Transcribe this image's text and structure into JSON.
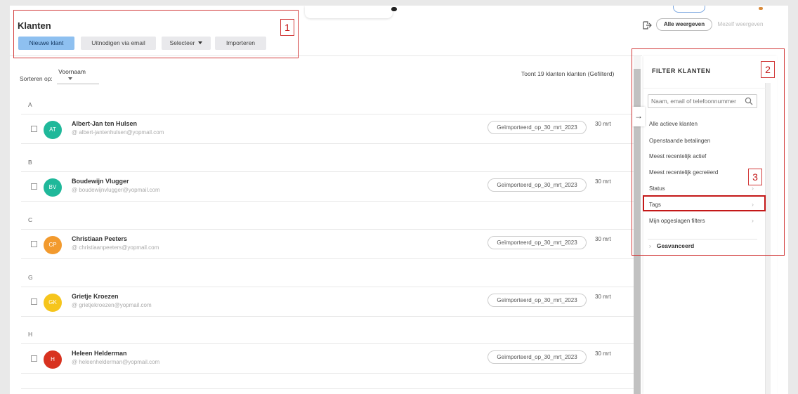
{
  "header": {
    "title": "Klanten",
    "buttons": {
      "new_client": "Nieuwe klant",
      "invite_email": "Uitnodigen via email",
      "select": "Selecteer",
      "import": "Importeren"
    },
    "view_all": "Alle weergeven",
    "view_self": "Mezelf weergeven"
  },
  "list": {
    "sort_label": "Sorteren op:",
    "sort_value": "Voornaam",
    "count_text": "Toont 19 klanten klanten (Gefilterd)",
    "sections": [
      {
        "letter": "A",
        "client": {
          "initials": "AT",
          "name": "Albert-Jan ten Hulsen",
          "email": "@  albert-jantenhulsen@yopmail.com",
          "tag": "Geïmporteerd_op_30_mrt_2023",
          "date": "30 mrt",
          "color": "#1fb89a"
        }
      },
      {
        "letter": "B",
        "client": {
          "initials": "BV",
          "name": "Boudewijn Vlugger",
          "email": "@  boudewijnvlugger@yopmail.com",
          "tag": "Geïmporteerd_op_30_mrt_2023",
          "date": "30 mrt",
          "color": "#1fb89a"
        }
      },
      {
        "letter": "C",
        "client": {
          "initials": "CP",
          "name": "Christiaan Peeters",
          "email": "@  christiaanpeeters@yopmail.com",
          "tag": "Geïmporteerd_op_30_mrt_2023",
          "date": "30 mrt",
          "color": "#f29a2e"
        }
      },
      {
        "letter": "G",
        "client": {
          "initials": "GK",
          "name": "Grietje Kroezen",
          "email": "@  grietjekroezen@yopmail.com",
          "tag": "Geïmporteerd_op_30_mrt_2023",
          "date": "30 mrt",
          "color": "#f6c51c"
        }
      },
      {
        "letter": "H",
        "client": {
          "initials": "H",
          "name": "Heleen Helderman",
          "email": "@  heleenhelderman@yopmail.com",
          "tag": "Geïmporteerd_op_30_mrt_2023",
          "date": "30 mrt",
          "color": "#d8321f"
        }
      }
    ]
  },
  "filter": {
    "title": "FILTER KLANTEN",
    "search_placeholder": "Naam, email of telefoonnummer",
    "items": [
      "Alle actieve klanten",
      "Openstaande betalingen",
      "Meest recentelijk actief",
      "Meest recentelijk gecreëerd",
      "Status",
      "Tags",
      "Mijn opgeslagen filters"
    ],
    "advanced": "Geavanceerd"
  },
  "annotations": [
    "1",
    "2",
    "3"
  ],
  "colors": {
    "primary_button": "#8ec0f0",
    "annotation": "#d23a3a"
  },
  "icons": [
    "export-icon",
    "search-icon",
    "arrow-right-icon",
    "chevron-right-icon",
    "caret-down-icon"
  ]
}
